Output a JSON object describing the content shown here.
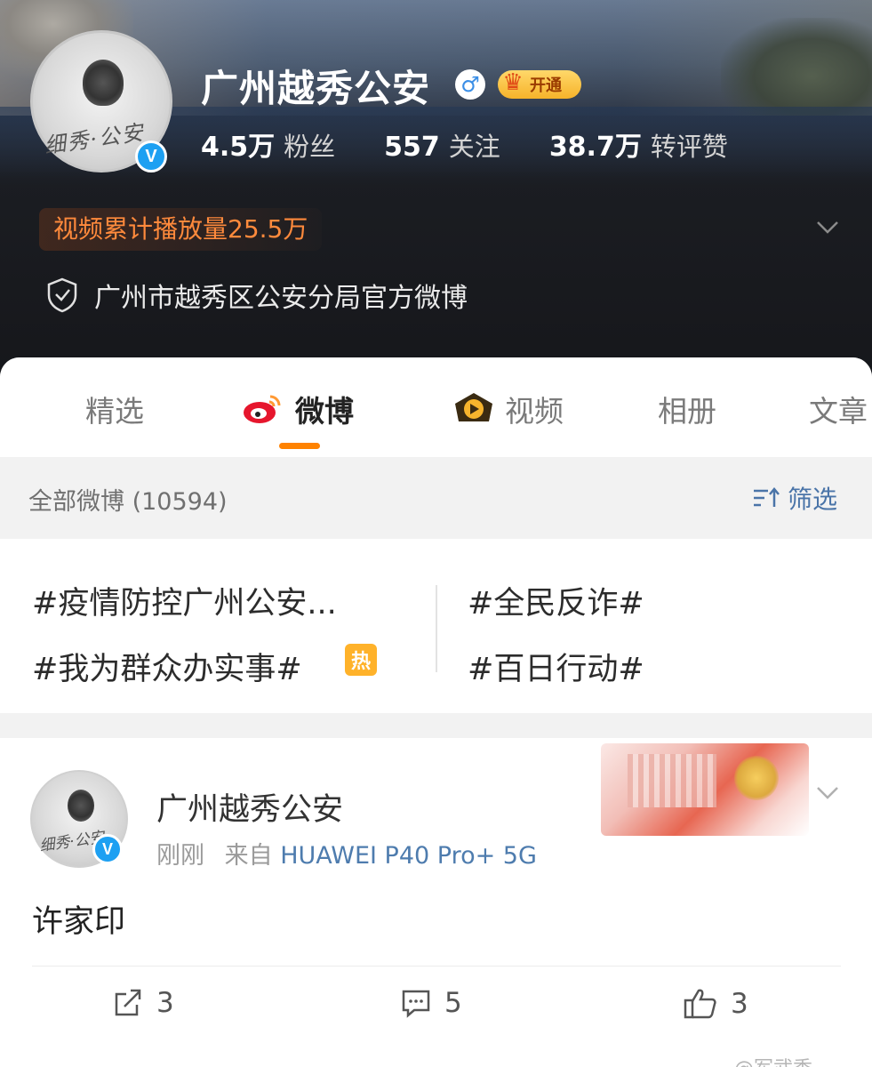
{
  "profile": {
    "name": "广州越秀公安",
    "gender_symbol": "♂",
    "vip_label": "开通",
    "avatar_signature": "细秀·公安",
    "verified_badge": "V",
    "stats": [
      {
        "num": "4.5万",
        "label": "粉丝"
      },
      {
        "num": "557",
        "label": "关注"
      },
      {
        "num": "38.7万",
        "label": "转评赞"
      }
    ],
    "play_count": "视频累计播放量25.5万",
    "verified_desc": "广州市越秀区公安分局官方微博"
  },
  "tabs": [
    {
      "label": "精选",
      "icon": "none"
    },
    {
      "label": "微博",
      "icon": "weibo-icon"
    },
    {
      "label": "视频",
      "icon": "video-icon"
    },
    {
      "label": "相册",
      "icon": "none"
    },
    {
      "label": "文章",
      "icon": "none"
    }
  ],
  "filter": {
    "all_label": "全部微博 (10594)",
    "filter_label": "筛选"
  },
  "topics": [
    {
      "text": "#疫情防控广州公安..."
    },
    {
      "text": "#全民反诈#"
    },
    {
      "text": "#我为群众办实事#"
    },
    {
      "text": "#百日行动#"
    }
  ],
  "hot_badge": "热",
  "post": {
    "author": "广州越秀公安",
    "time": "刚刚",
    "source_prefix": "来自",
    "device": "HUAWEI P40 Pro+ 5G",
    "text": "许家印",
    "actions": {
      "repost": "3",
      "comment": "5",
      "like": "3"
    }
  },
  "watermark": "@军武季",
  "colors": {
    "accent": "#ff8200",
    "link": "#4e7cae",
    "playcount": "#ff8a3c",
    "verified_blue": "#1da0f2"
  }
}
